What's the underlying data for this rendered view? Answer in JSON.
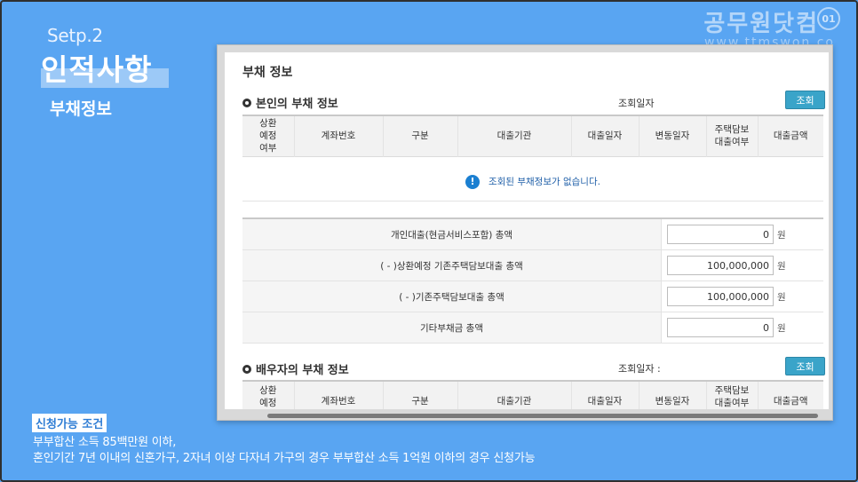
{
  "overlay": {
    "step": "Setp.2",
    "section_title": "인적사항",
    "subtitle": "부채정보",
    "watermark": "공무원닷컴",
    "watermark_sub": "www.ttmswon.co",
    "watermark_logo": "01",
    "condition_badge": "신청가능 조건",
    "condition_lines": [
      "부부합산 소득 85백만원 이하,",
      "혼인기간 7년 이내의 신혼가구, 2자녀 이상 다자녀 가구의 경우 부부합산 소득 1억원 이하의 경우 신청가능"
    ]
  },
  "panel": {
    "title": "부채 정보",
    "own": {
      "heading": "본인의 부채 정보",
      "query_label": "조회일자",
      "query_button": "조회",
      "columns": [
        "상환\n예정\n여부",
        "계좌번호",
        "구분",
        "대출기관",
        "대출일자",
        "변동일자",
        "주택담보\n대출여부",
        "대출금액"
      ],
      "empty_message": "조회된 부채정보가 없습니다."
    },
    "summary": [
      {
        "label": "개인대출(현금서비스포함) 총액",
        "value": "0",
        "unit": "원"
      },
      {
        "label": "( - )상환예정 기존주택담보대출 총액",
        "value": "100,000,000",
        "unit": "원"
      },
      {
        "label": "( - )기존주택담보대출 총액",
        "value": "100,000,000",
        "unit": "원"
      },
      {
        "label": "기타부채금 총액",
        "value": "0",
        "unit": "원"
      }
    ],
    "spouse": {
      "heading": "배우자의 부채 정보",
      "query_label": "조회일자 :",
      "query_button": "조회",
      "columns": [
        "상환\n예정",
        "계좌번호",
        "구분",
        "대출기관",
        "대출일자",
        "변동일자",
        "주택담보\n대출여부",
        "대출금액"
      ]
    }
  },
  "colors": {
    "background": "#59a5f2",
    "button": "#3aa4c9",
    "info": "#1b7fd1"
  }
}
